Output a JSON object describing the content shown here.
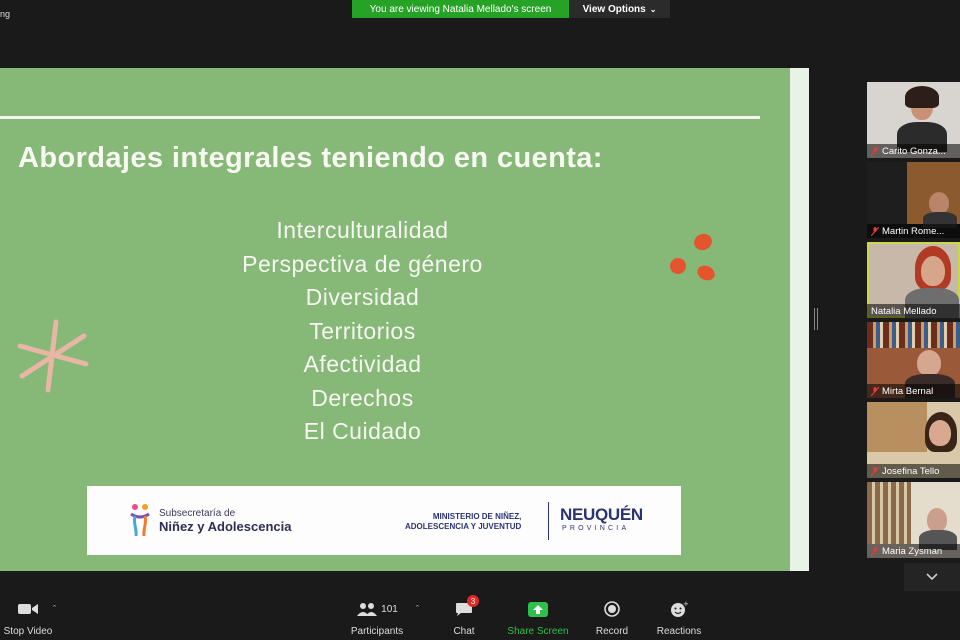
{
  "window": {
    "title_fragment": "ng"
  },
  "banner": {
    "text": "You are viewing Natalia Mellado's screen",
    "view_options": "View Options"
  },
  "slide": {
    "title": "Abordajes integrales teniendo en cuenta:",
    "items": [
      "Interculturalidad",
      "Perspectiva de género",
      "Diversidad",
      "Territorios",
      "Afectividad",
      "Derechos",
      "El Cuidado"
    ],
    "logos": {
      "sub_line1": "Subsecretaría de",
      "sub_line2": "Niñez y Adolescencia",
      "ministerio_line1": "MINISTERIO DE NIÑEZ,",
      "ministerio_line2": "ADOLESCENCIA Y JUVENTUD",
      "neuquen": "NEUQUÉN",
      "provincia": "PROVINCIA"
    },
    "colors": {
      "background": "#86b878",
      "accent_star": "#e8b6a5",
      "accent_dots": "#e4552e"
    }
  },
  "participants_gallery": [
    {
      "name": "Carito Gonzalez",
      "display": "Carito Gonza...",
      "muted": true,
      "active": false
    },
    {
      "name": "Martin Romero",
      "display": "Martin Rome...",
      "muted": true,
      "active": false
    },
    {
      "name": "Natalia Mellado",
      "display": "Natalia Mellado",
      "muted": false,
      "active": true
    },
    {
      "name": "Mirta Bernal",
      "display": "Mirta Bernal",
      "muted": true,
      "active": false
    },
    {
      "name": "Josefina Tello",
      "display": "Josefina Tello",
      "muted": true,
      "active": false
    },
    {
      "name": "Maria Zysman",
      "display": "Maria Zysman",
      "muted": true,
      "active": false
    }
  ],
  "toolbar": {
    "stop_video": "Stop Video",
    "participants": "Participants",
    "participants_count": "101",
    "chat": "Chat",
    "chat_badge": "3",
    "share_screen": "Share Screen",
    "record": "Record",
    "reactions": "Reactions"
  },
  "icons": [
    "video-camera-icon",
    "participants-icon",
    "chat-icon",
    "share-screen-icon",
    "record-icon",
    "reactions-icon",
    "mic-muted-icon",
    "chevron-down-icon",
    "chevron-up-icon"
  ]
}
